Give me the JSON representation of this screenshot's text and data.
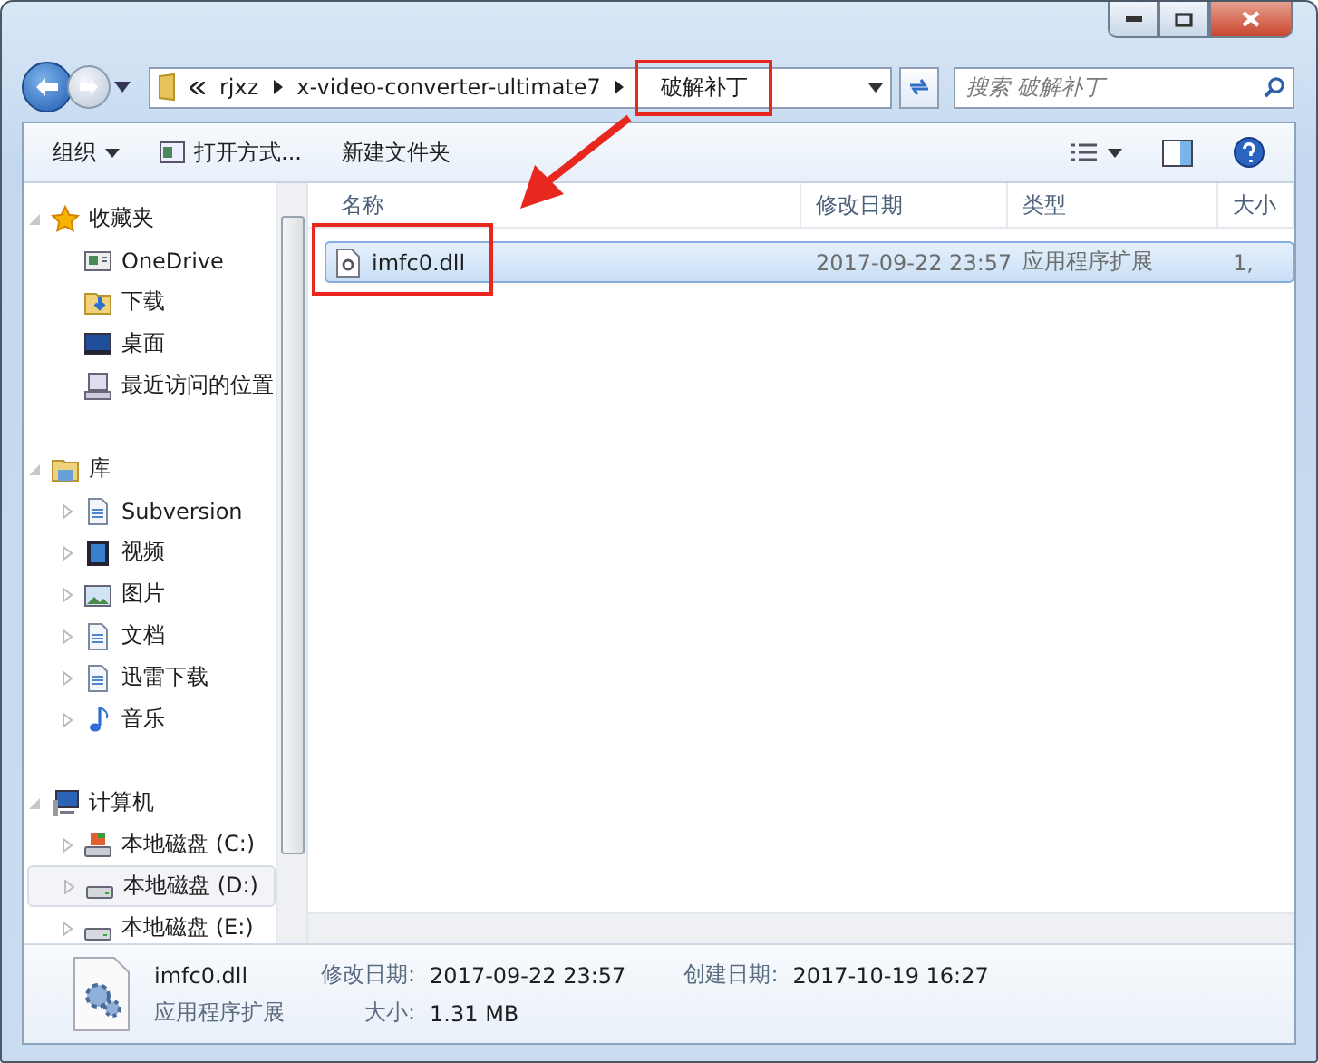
{
  "address": {
    "crumbs": [
      {
        "label": "rjxz",
        "callout": false
      },
      {
        "label": "x-video-converter-ultimate7",
        "callout": false
      },
      {
        "label": "破解补丁",
        "callout": true
      }
    ]
  },
  "search": {
    "placeholder": "搜索 破解补丁"
  },
  "toolbar": {
    "organize": "组织",
    "open_with": "打开方式...",
    "new_folder": "新建文件夹"
  },
  "sidebar": {
    "groups": [
      {
        "label": "收藏夹",
        "kind": "favorites",
        "expanded": true,
        "children": [
          {
            "label": "OneDrive",
            "kind": "cloud"
          },
          {
            "label": "下载",
            "kind": "downloads"
          },
          {
            "label": "桌面",
            "kind": "desktop"
          },
          {
            "label": "最近访问的位置",
            "kind": "recent"
          }
        ]
      },
      {
        "label": "库",
        "kind": "library",
        "expanded": true,
        "children": [
          {
            "label": "Subversion",
            "kind": "doc",
            "expanded": false
          },
          {
            "label": "视频",
            "kind": "video",
            "expanded": false
          },
          {
            "label": "图片",
            "kind": "pictures",
            "expanded": false
          },
          {
            "label": "文档",
            "kind": "doc",
            "expanded": false
          },
          {
            "label": "迅雷下载",
            "kind": "doc",
            "expanded": false
          },
          {
            "label": "音乐",
            "kind": "music",
            "expanded": false
          }
        ]
      },
      {
        "label": "计算机",
        "kind": "computer",
        "expanded": true,
        "children": [
          {
            "label": "本地磁盘 (C:)",
            "kind": "system-drive",
            "expanded": false,
            "selected": false
          },
          {
            "label": "本地磁盘 (D:)",
            "kind": "drive",
            "expanded": false,
            "selected": true
          },
          {
            "label": "本地磁盘 (E:)",
            "kind": "drive",
            "expanded": false,
            "selected": false
          }
        ]
      }
    ]
  },
  "table": {
    "columns": [
      "名称",
      "修改日期",
      "类型",
      "大小"
    ],
    "rows": [
      {
        "name": "imfc0.dll",
        "modified": "2017-09-22 23:57",
        "type": "应用程序扩展",
        "size": "1,",
        "selected": true,
        "callout": true
      }
    ]
  },
  "details": {
    "name": "imfc0.dll",
    "type": "应用程序扩展",
    "fields": [
      {
        "label": "修改日期:",
        "value": "2017-09-22 23:57"
      },
      {
        "label": "大小:",
        "value": "1.31 MB"
      },
      {
        "label": "创建日期:",
        "value": "2017-10-19 16:27"
      }
    ]
  }
}
